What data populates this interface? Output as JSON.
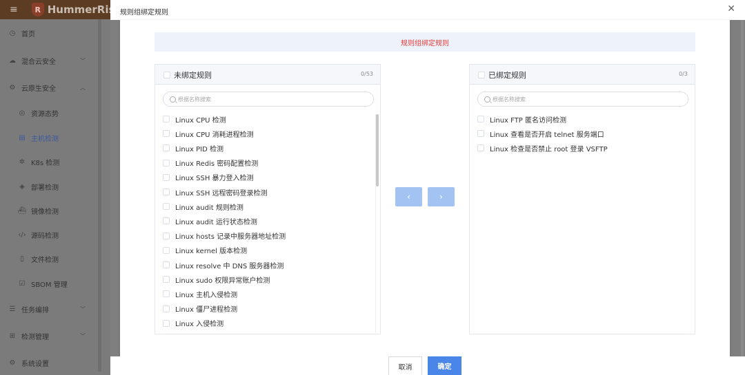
{
  "app": {
    "logo_text": "HummerRisk"
  },
  "sidebar": {
    "items": [
      {
        "label": "首页",
        "icon": "clock-icon",
        "glyph": "◷",
        "level": "top"
      },
      {
        "label": "混合云安全",
        "icon": "cloud-icon",
        "glyph": "☁",
        "level": "top",
        "chevron": "﹀"
      },
      {
        "label": "云原生安全",
        "icon": "cloud-native-icon",
        "glyph": "⚙",
        "level": "top",
        "chevron": "︿"
      },
      {
        "label": "资源态势",
        "icon": "resource-icon",
        "glyph": "◎",
        "level": "sub"
      },
      {
        "label": "主机检测",
        "icon": "host-icon",
        "glyph": "▤",
        "level": "sub",
        "active": true
      },
      {
        "label": "K8s 检测",
        "icon": "k8s-icon",
        "glyph": "✲",
        "level": "sub"
      },
      {
        "label": "部署检测",
        "icon": "deploy-icon",
        "glyph": "◈",
        "level": "sub"
      },
      {
        "label": "镜像检测",
        "icon": "image-icon",
        "glyph": "⛴",
        "level": "sub"
      },
      {
        "label": "源码检测",
        "icon": "code-icon",
        "glyph": "‹/›",
        "level": "sub"
      },
      {
        "label": "文件检测",
        "icon": "file-icon",
        "glyph": "▯",
        "level": "sub"
      },
      {
        "label": "SBOM 管理",
        "icon": "sbom-icon",
        "glyph": "☑",
        "level": "sub"
      },
      {
        "label": "任务编排",
        "icon": "task-icon",
        "glyph": "☰",
        "level": "top",
        "chevron": "﹀"
      },
      {
        "label": "检测管理",
        "icon": "manage-icon",
        "glyph": "⊞",
        "level": "top",
        "chevron": "﹀"
      },
      {
        "label": "系统设置",
        "icon": "settings-icon",
        "glyph": "⚙",
        "level": "top"
      }
    ]
  },
  "modal": {
    "title": "规则组绑定规则",
    "banner": "规则组绑定规则",
    "left_panel": {
      "title": "未绑定规则",
      "count": "0/53",
      "search_placeholder": "根据名称搜索",
      "items": [
        "Linux CPU 检测",
        "Linux CPU 消耗进程检测",
        "Linux PID 检测",
        "Linux Redis 密码配置检测",
        "Linux SSH 暴力登入检测",
        "Linux SSH 远程密码登录检测",
        "Linux audit 规则检测",
        "Linux audit 运行状态检测",
        "Linux hosts 记录中服务器地址检测",
        "Linux kernel 版本检测",
        "Linux resolve 中 DNS 服务器检测",
        "Linux sudo 权限异常账户检测",
        "Linux 主机入侵检测",
        "Linux 僵尸进程检测",
        "Linux 入侵检测"
      ]
    },
    "right_panel": {
      "title": "已绑定规则",
      "count": "0/3",
      "search_placeholder": "根据名称搜索",
      "items": [
        "Linux FTP 匿名访问检测",
        "Linux 查看是否开启 telnet 服务端口",
        "Linux 检查是否禁止 root 登录 VSFTP"
      ]
    },
    "transfer": {
      "left_arrow": "‹",
      "right_arrow": "›"
    },
    "footer": {
      "cancel_label": "取消",
      "ok_label": "确定"
    }
  }
}
